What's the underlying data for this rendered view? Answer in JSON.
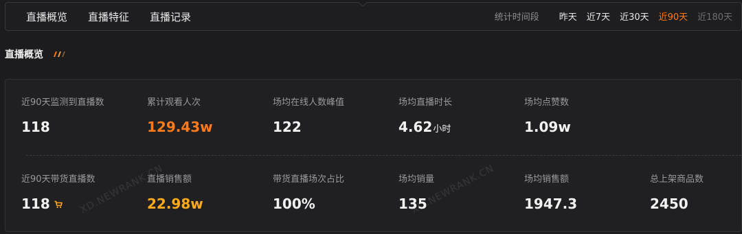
{
  "tabs": [
    "直播概览",
    "直播特征",
    "直播记录"
  ],
  "period": {
    "label": "统计时间段",
    "options": [
      "昨天",
      "近7天",
      "近30天",
      "近90天",
      "近180天"
    ],
    "selected": "近90天"
  },
  "section_title": "直播概览",
  "stats_row1": [
    {
      "label": "近90天监测到直播数",
      "value": "118"
    },
    {
      "label": "累计观看人次",
      "value": "129.43w"
    },
    {
      "label": "场均在线人数峰值",
      "value": "122"
    },
    {
      "label": "场均直播时长",
      "value": "4.62",
      "unit": "小时"
    },
    {
      "label": "场均点赞数",
      "value": "1.09w"
    }
  ],
  "stats_row2": [
    {
      "label": "近90天带货直播数",
      "value": "118"
    },
    {
      "label": "直播销售额",
      "value": "22.98w"
    },
    {
      "label": "带货直播场次占比",
      "value": "100%"
    },
    {
      "label": "场均销量",
      "value": "135"
    },
    {
      "label": "场均销售额",
      "value": "1947.3"
    },
    {
      "label": "总上架商品数",
      "value": "2450"
    }
  ],
  "watermark": "XD.NEWRANK.CN",
  "colors": {
    "accent": "#ff7a1a",
    "amber": "#ffaa1d",
    "background": "#1c1c1e"
  },
  "icons": {
    "cart": "shopping-cart-icon"
  }
}
